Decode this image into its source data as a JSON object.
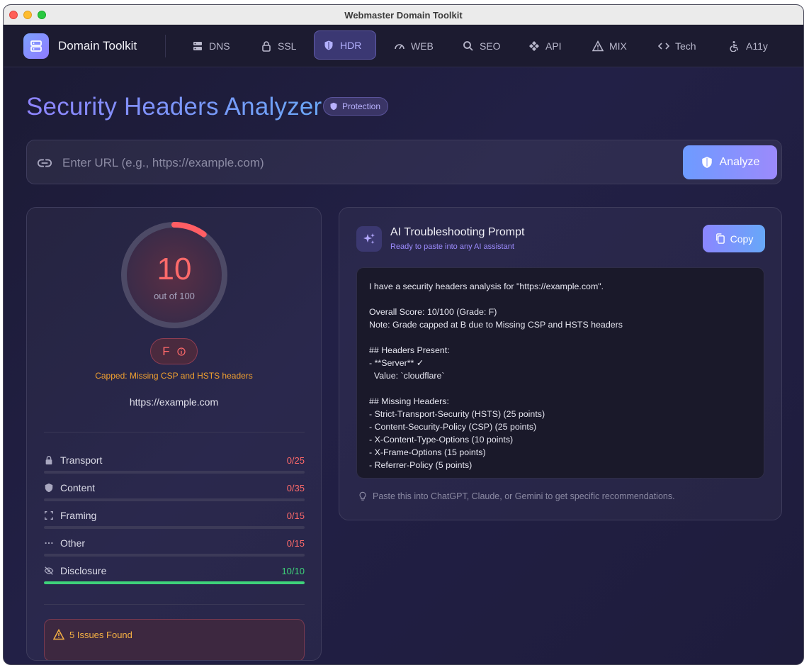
{
  "window": {
    "title": "Webmaster Domain Toolkit"
  },
  "nav": {
    "brand": "Domain Toolkit",
    "items": [
      {
        "label": "DNS",
        "icon": "server-icon",
        "active": false
      },
      {
        "label": "SSL",
        "icon": "lock-icon",
        "active": false
      },
      {
        "label": "HDR",
        "icon": "shield-icon",
        "active": true
      },
      {
        "label": "WEB",
        "icon": "gauge-icon",
        "active": false
      },
      {
        "label": "SEO",
        "icon": "search-icon",
        "active": false
      },
      {
        "label": "API",
        "icon": "diamond-arrows-icon",
        "active": false
      },
      {
        "label": "MIX",
        "icon": "warning-icon",
        "active": false
      },
      {
        "label": "Tech",
        "icon": "code-icon",
        "active": false
      },
      {
        "label": "A11y",
        "icon": "accessibility-icon",
        "active": false
      }
    ]
  },
  "header": {
    "title": "Security Headers Analyzer",
    "badge": "Protection"
  },
  "search": {
    "placeholder": "Enter URL (e.g., https://example.com)",
    "value": "",
    "button": "Analyze"
  },
  "score": {
    "value": "10",
    "max_label": "out of 100",
    "fraction": 0.1,
    "grade": "F",
    "note": "Capped: Missing CSP and HSTS headers",
    "url": "https://example.com"
  },
  "categories": [
    {
      "label": "Transport",
      "score": "0/25",
      "fraction": 0,
      "icon": "lock-icon"
    },
    {
      "label": "Content",
      "score": "0/35",
      "fraction": 0,
      "icon": "shield-icon"
    },
    {
      "label": "Framing",
      "score": "0/15",
      "fraction": 0,
      "icon": "frame-icon"
    },
    {
      "label": "Other",
      "score": "0/15",
      "fraction": 0,
      "icon": "ellipsis-icon"
    },
    {
      "label": "Disclosure",
      "score": "10/10",
      "fraction": 1,
      "icon": "eye-off-icon"
    }
  ],
  "issues": {
    "label": "5 Issues Found"
  },
  "prompt": {
    "title": "AI Troubleshooting Prompt",
    "subtitle": "Ready to paste into any AI assistant",
    "copy": "Copy",
    "text": "I have a security headers analysis for \"https://example.com\".\n\nOverall Score: 10/100 (Grade: F)\nNote: Grade capped at B due to Missing CSP and HSTS headers\n\n## Headers Present:\n- **Server** ✓\n  Value: `cloudflare`\n\n## Missing Headers:\n- Strict-Transport-Security (HSTS) (25 points)\n- Content-Security-Policy (CSP) (25 points)\n- X-Content-Type-Options (10 points)\n- X-Frame-Options (15 points)\n- Referrer-Policy (5 points)",
    "tip": "Paste this into ChatGPT, Claude, or Gemini to get specific recommendations."
  },
  "colors": {
    "accent": "#8b86ff",
    "danger": "#ff6a6a",
    "success": "#3ed27a",
    "warning": "#f0a030"
  }
}
